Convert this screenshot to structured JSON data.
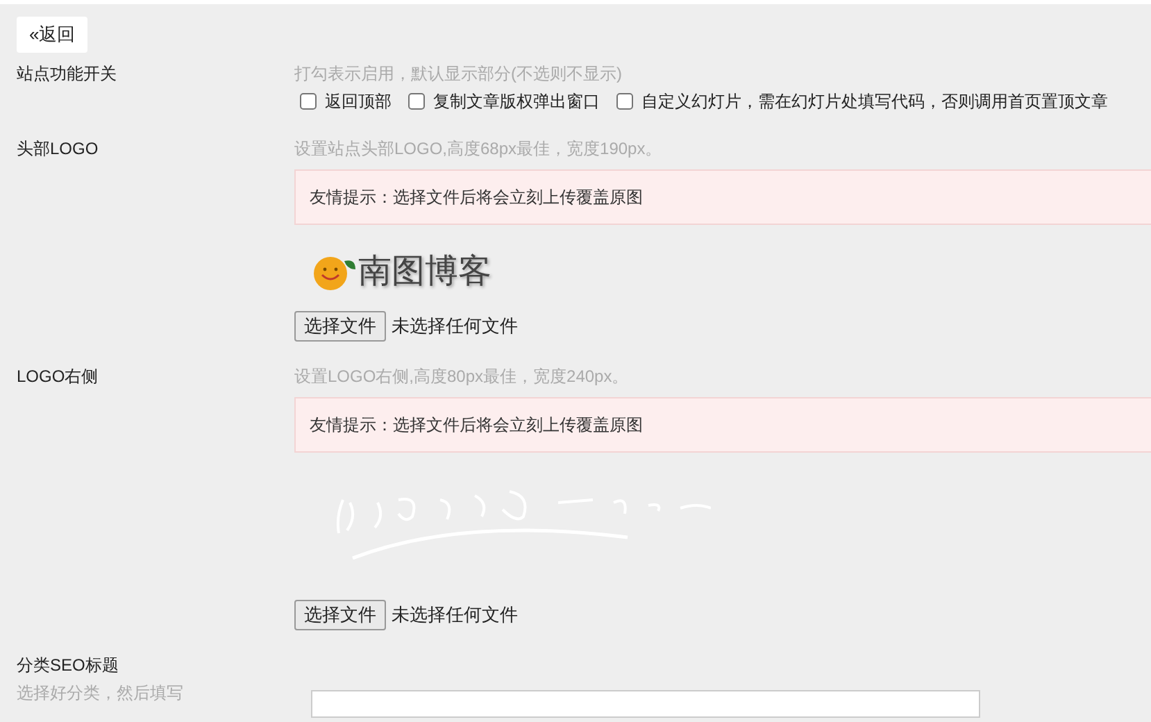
{
  "back_button": "«返回",
  "sections": [
    {
      "kind": "checkboxes",
      "label": "站点功能开关",
      "hint": "打勾表示启用，默认显示部分(不选则不显示)",
      "options": [
        {
          "label": "返回顶部",
          "checked": false
        },
        {
          "label": "复制文章版权弹出窗口",
          "checked": false
        },
        {
          "label": "自定义幻灯片，需在幻灯片处填写代码，否则调用首页置顶文章",
          "checked": false
        }
      ]
    },
    {
      "kind": "upload",
      "label": "头部LOGO",
      "hint": "设置站点头部LOGO,高度68px最佳，宽度190px。",
      "notice": "友情提示：选择文件后将会立刻上传覆盖原图",
      "preview": {
        "kind": "logo",
        "text": "南图博客"
      },
      "file_button": "选择文件",
      "file_status": "未选择任何文件"
    },
    {
      "kind": "upload",
      "label": "LOGO右侧",
      "hint": "设置LOGO右侧,高度80px最佳，宽度240px。",
      "notice": "友情提示：选择文件后将会立刻上传覆盖原图",
      "file_button": "选择文件",
      "file_status": "未选择任何文件"
    },
    {
      "kind": "text",
      "label": "分类SEO标题",
      "hint": "选择好分类，然后填写"
    }
  ]
}
